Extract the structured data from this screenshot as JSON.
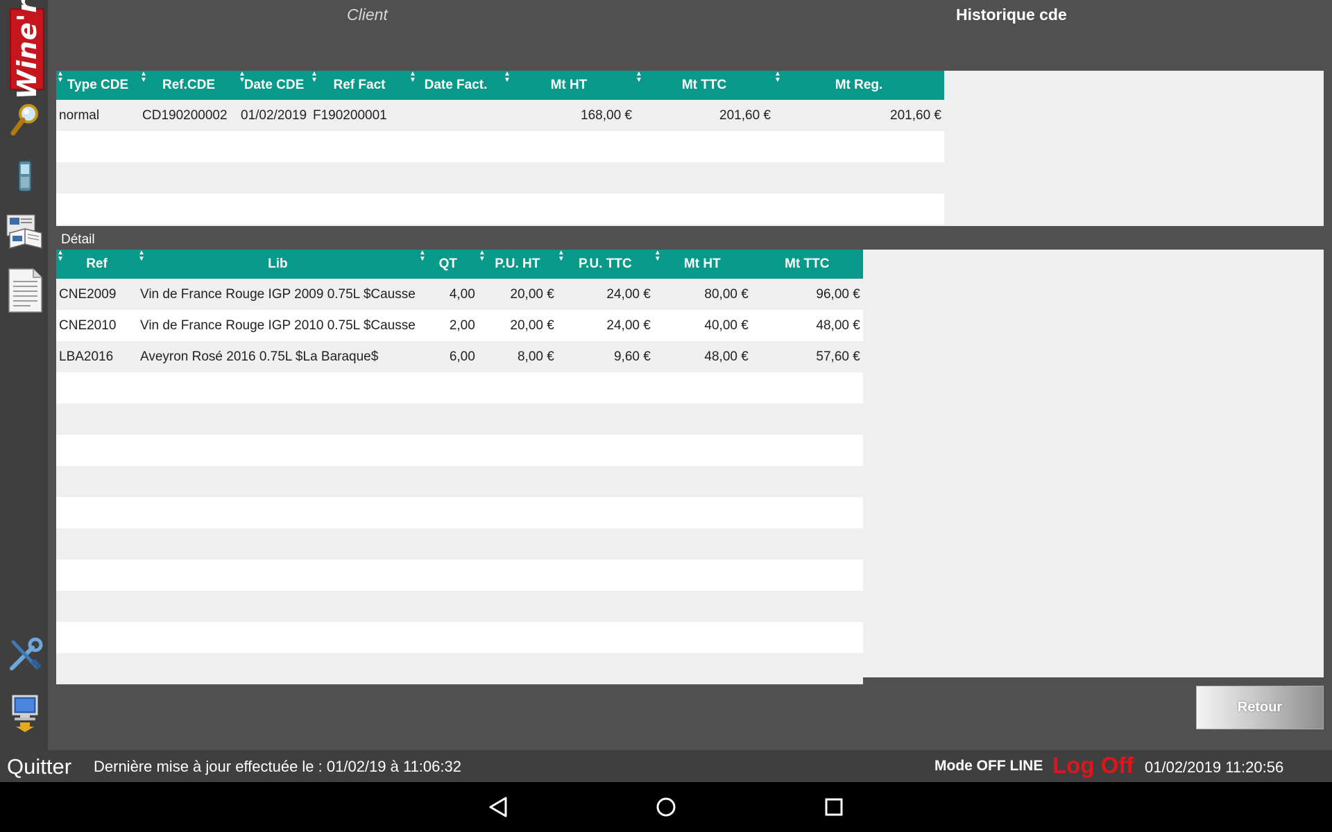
{
  "app": {
    "logo_text": "Wine'r",
    "title": "Historique cde"
  },
  "client": {
    "label": "Client"
  },
  "sidebar": {
    "items": [
      {
        "icon": "search-icon"
      },
      {
        "icon": "mobile-phone-icon"
      },
      {
        "icon": "catalog-icon"
      },
      {
        "icon": "document-icon"
      },
      {
        "icon": "tools-icon"
      },
      {
        "icon": "computer-sync-icon"
      }
    ]
  },
  "orders": {
    "columns": [
      "Type CDE",
      "Ref.CDE",
      "Date CDE",
      "Ref Fact",
      "Date Fact.",
      "Mt HT",
      "Mt TTC",
      "Mt Reg."
    ],
    "rows": [
      {
        "type": "normal",
        "ref_cde": "CD190200002",
        "date_cde": "01/02/2019",
        "ref_fact": "F190200001",
        "date_fact": "",
        "mt_ht": "168,00 €",
        "mt_ttc": "201,60 €",
        "mt_reg": "201,60 €"
      }
    ],
    "empty_rows": 3
  },
  "detail": {
    "label": "Détail",
    "columns": [
      "Ref",
      "Lib",
      "QT",
      "P.U. HT",
      "P.U. TTC",
      "Mt HT",
      "Mt TTC"
    ],
    "rows": [
      {
        "ref": "CNE2009",
        "lib": "Vin de France Rouge IGP 2009 0.75L $Causse",
        "qt": "4,00",
        "pu_ht": "20,00 €",
        "pu_ttc": "24,00 €",
        "mt_ht": "80,00 €",
        "mt_ttc": "96,00 €"
      },
      {
        "ref": "CNE2010",
        "lib": "Vin de France Rouge IGP 2010 0.75L $Causse",
        "qt": "2,00",
        "pu_ht": "20,00 €",
        "pu_ttc": "24,00 €",
        "mt_ht": "40,00 €",
        "mt_ttc": "48,00 €"
      },
      {
        "ref": "LBA2016",
        "lib": "Aveyron Rosé  2016 0.75L $La Baraque$",
        "qt": "6,00",
        "pu_ht": "8,00 €",
        "pu_ttc": "9,60 €",
        "mt_ht": "48,00 €",
        "mt_ttc": "57,60 €"
      }
    ],
    "empty_rows": 10
  },
  "actions": {
    "retour": "Retour"
  },
  "status": {
    "quit": "Quitter",
    "last_update": "Dernière mise à jour effectuée le : 01/02/19 à 11:06:32",
    "mode": "Mode OFF LINE",
    "logoff": "Log Off",
    "datetime": "01/02/2019 11:20:56"
  },
  "colors": {
    "header_teal": "#079a8a",
    "logoff_red": "#e0151b",
    "logo_red": "#c4161c",
    "background": "#505050"
  },
  "navbar": {
    "buttons": [
      "back-icon",
      "home-icon",
      "recents-icon"
    ]
  }
}
